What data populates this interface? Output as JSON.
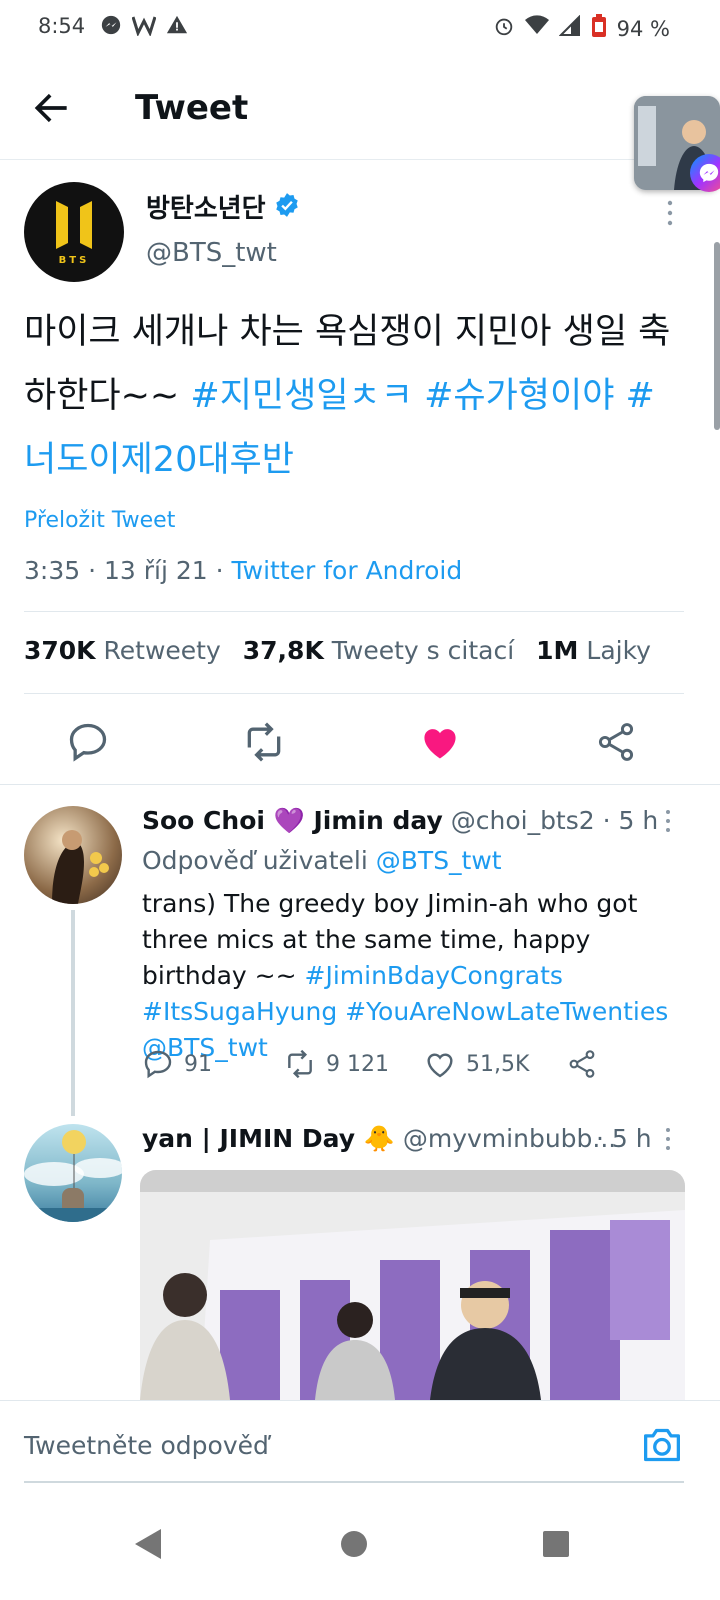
{
  "status_bar": {
    "time": "8:54",
    "battery": "94 %"
  },
  "header": {
    "title": "Tweet"
  },
  "tweet": {
    "display_name": "방탄소년단",
    "handle": "@BTS_twt",
    "avatar_text": "BTS",
    "text_plain": "마이크 세개나 차는 욕심쟁이 지민아 생일 축하한다~~ ",
    "hashtags": [
      "#지민생일ㅊㅋ",
      "#슈가형이야",
      "#너도이제20대후반"
    ],
    "translate_label": "Přeložit Tweet",
    "time": "3:35 · 13 říj 21 · ",
    "source": "Twitter for Android",
    "stats": {
      "retweets_count": "370K",
      "retweets_label": "Retweety",
      "quotes_count": "37,8K",
      "quotes_label": "Tweety s citací",
      "likes_count": "1M",
      "likes_label": "Lajky"
    },
    "liked": true,
    "colors": {
      "like": "#f91880",
      "link": "#1d9bf0"
    }
  },
  "replies": [
    {
      "name": "Soo Choi 💜 Jimin day",
      "handle": "@choi_bts2",
      "time": "· 5 h",
      "reply_to_label": "Odpověď uživateli",
      "reply_to_handle": "@BTS_twt",
      "text_plain": "trans) The greedy boy Jimin-ah who got three mics at the same time, happy birthday ~~ ",
      "links": [
        "#JiminBdayCongrats",
        "#ItsSugaHyung",
        "#YouAreNowLateTwenties",
        "@BTS_twt"
      ],
      "reply_count": "91",
      "retweet_count": "9 121",
      "like_count": "51,5K"
    },
    {
      "name": "yan | JIMIN Day 🐥",
      "handle": "@myvminbubb...",
      "time": "· 5 h"
    }
  ],
  "compose": {
    "placeholder": "Tweetněte odpověď"
  }
}
